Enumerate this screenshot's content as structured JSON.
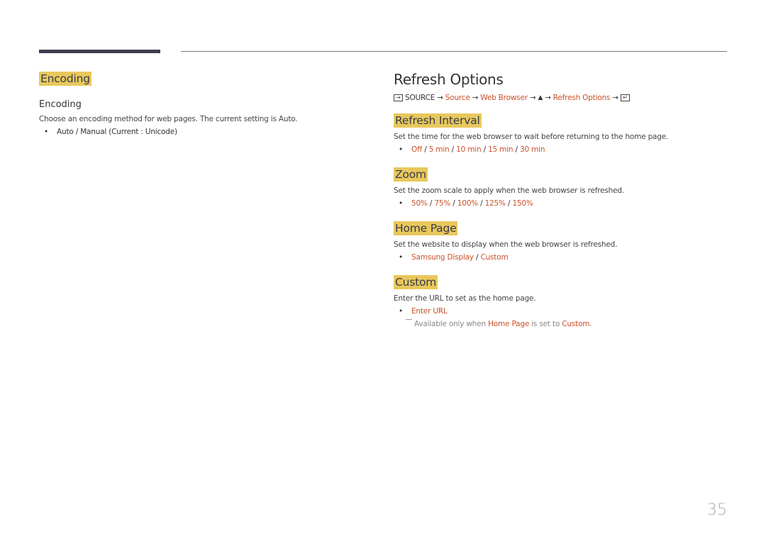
{
  "left": {
    "section_title": "Encoding",
    "subheading": "Encoding",
    "description": "Choose an encoding method for web pages. The current setting is Auto.",
    "options": "Auto / Manual (Current : Unicode)"
  },
  "right": {
    "title": "Refresh Options",
    "path": {
      "source_icon": "source-input-icon",
      "start": "SOURCE",
      "arrow": "→",
      "source": "Source",
      "web_browser": "Web Browser",
      "up_glyph": "▲",
      "refresh_options": "Refresh Options",
      "enter_icon": "enter-icon"
    },
    "sections": [
      {
        "title": "Refresh Interval",
        "description": "Set the time for the web browser to wait before returning to the home page.",
        "options": [
          "Off",
          "5 min",
          "10 min",
          "15 min",
          "30 min"
        ]
      },
      {
        "title": "Zoom",
        "description": "Set the zoom scale to apply when the web browser is refreshed.",
        "options": [
          "50%",
          "75%",
          "100%",
          "125%",
          "150%"
        ]
      },
      {
        "title": "Home Page",
        "description": "Set the website to display when the web browser is refreshed.",
        "options": [
          "Samsung Display",
          "Custom"
        ]
      },
      {
        "title": "Custom",
        "description": "Enter the URL to set as the home page.",
        "options": [
          "Enter URL"
        ],
        "note": {
          "prefix": "Available only when ",
          "link1": "Home Page",
          "middle": " is set to ",
          "link2": "Custom",
          "suffix": "."
        }
      }
    ]
  },
  "separator": " / ",
  "page_number": "35",
  "colors": {
    "highlight": "#e8c85c",
    "link": "#c8502a",
    "rule": "#3d3d4f"
  }
}
